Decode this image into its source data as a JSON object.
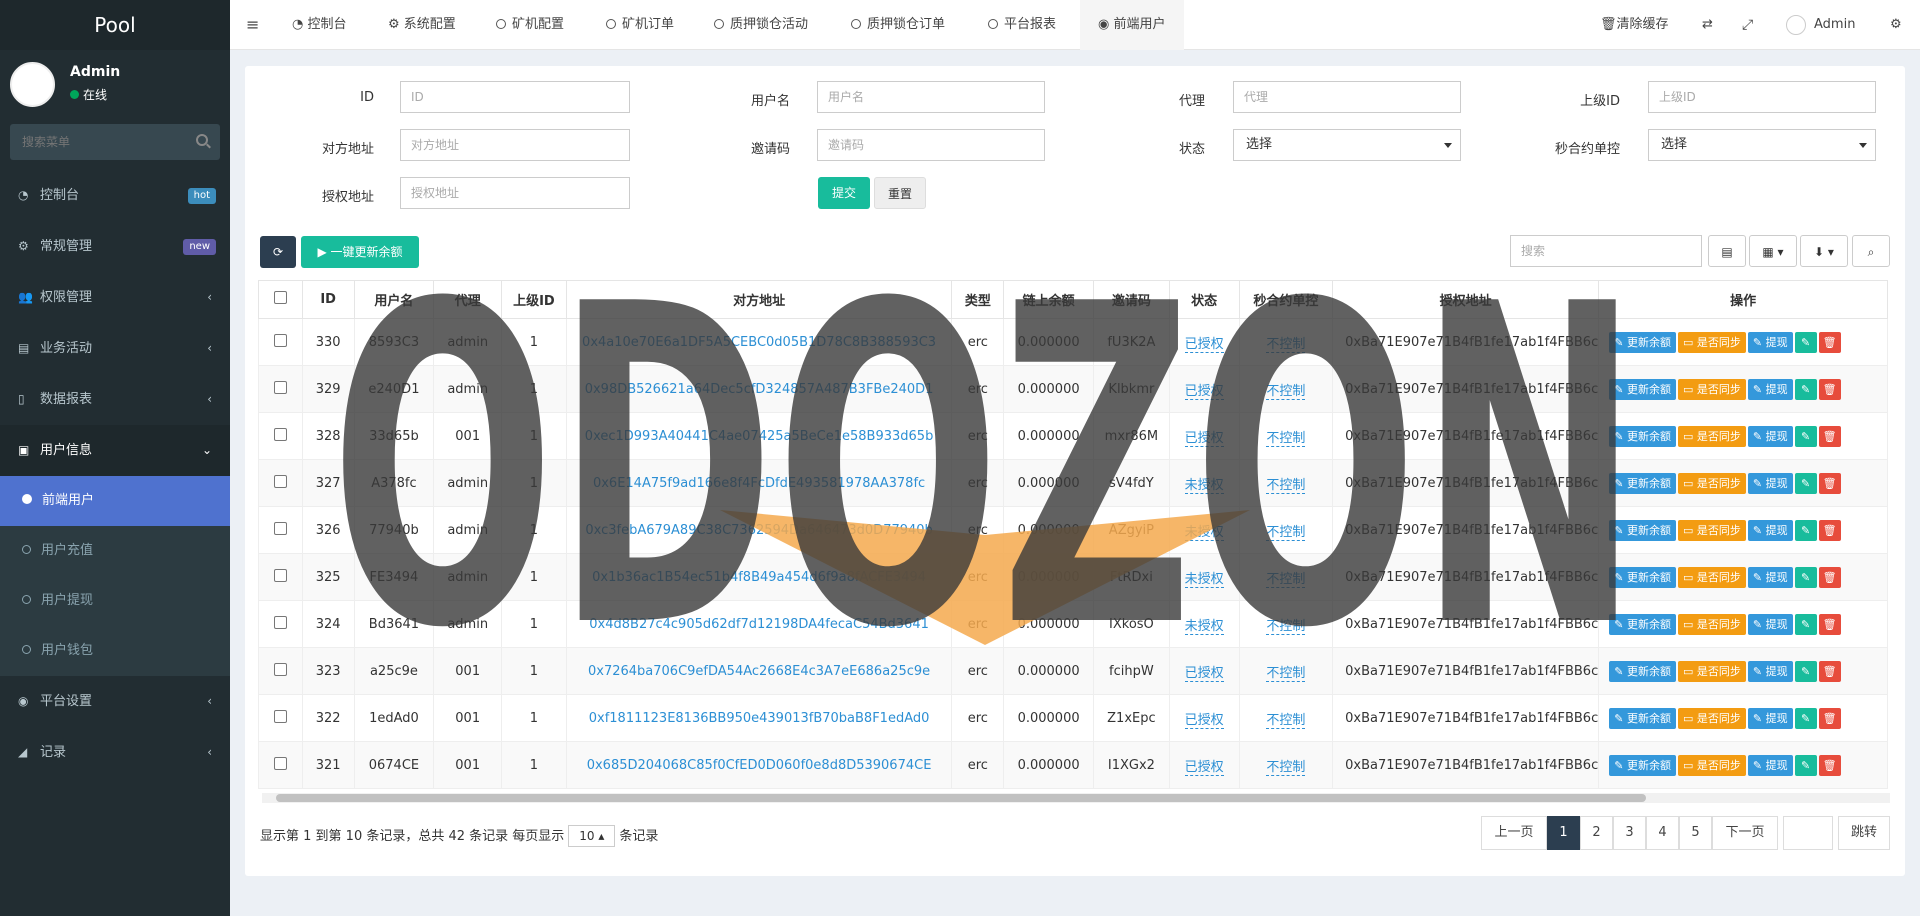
{
  "sidebar": {
    "logo": "Pool",
    "user": {
      "name": "Admin",
      "status": "在线"
    },
    "search_placeholder": "搜索菜单",
    "menu": [
      {
        "label": "控制台",
        "badge": "hot"
      },
      {
        "label": "常规管理",
        "badge": "new"
      },
      {
        "label": "权限管理"
      },
      {
        "label": "业务活动"
      },
      {
        "label": "数据报表"
      },
      {
        "label": "用户信息"
      },
      {
        "label": "平台设置"
      },
      {
        "label": "记录"
      }
    ],
    "submenu": [
      "前端用户",
      "用户充值",
      "用户提现",
      "用户钱包"
    ]
  },
  "topnav": {
    "tabs": [
      "控制台",
      "系统配置",
      "矿机配置",
      "矿机订单",
      "质押锁仓活动",
      "质押锁仓订单",
      "平台报表",
      "前端用户"
    ],
    "clear_cache": "清除缓存",
    "user": "Admin"
  },
  "filters": {
    "id": {
      "label": "ID",
      "placeholder": "ID"
    },
    "username": {
      "label": "用户名",
      "placeholder": "用户名"
    },
    "agent": {
      "label": "代理",
      "placeholder": "代理"
    },
    "parent_id": {
      "label": "上级ID",
      "placeholder": "上级ID"
    },
    "address": {
      "label": "对方地址",
      "placeholder": "对方地址"
    },
    "invite": {
      "label": "邀请码",
      "placeholder": "邀请码"
    },
    "status": {
      "label": "状态",
      "value": "选择"
    },
    "contract": {
      "label": "秒合约单控",
      "value": "选择"
    },
    "auth": {
      "label": "授权地址",
      "placeholder": "授权地址"
    },
    "submit": "提交",
    "reset": "重置"
  },
  "toolbar": {
    "update_all": "一键更新余额",
    "search_placeholder": "搜索"
  },
  "table": {
    "headers": [
      "ID",
      "用户名",
      "代理",
      "上级ID",
      "对方地址",
      "类型",
      "链上余额",
      "邀请码",
      "状态",
      "秒合约单控",
      "授权地址",
      "操作"
    ],
    "rows": [
      [
        "330",
        "8593C3",
        "admin",
        "1",
        "0x4a10e70E6a1DF5A5CEBC0d05B1D78C8B388593C3",
        "erc",
        "0.000000",
        "fU3K2A",
        "已授权",
        "不控制",
        "0xBa71E907e71B4fB1fe17ab1f4FBB6c"
      ],
      [
        "329",
        "e240D1",
        "admin",
        "1",
        "0x98DB526621a64Dec5cfD324857A487B3FBe240D1",
        "erc",
        "0.000000",
        "Klbkmr",
        "已授权",
        "不控制",
        "0xBa71E907e71B4fB1fe17ab1f4FBB6c"
      ],
      [
        "328",
        "33d65b",
        "001",
        "1",
        "0xec1D993A40441C4ae07425a5BeCe1e58B933d65b",
        "erc",
        "0.000000",
        "mxr86M",
        "已授权",
        "不控制",
        "0xBa71E907e71B4fB1fe17ab1f4FBB6c"
      ],
      [
        "327",
        "A378fc",
        "admin",
        "1",
        "0x6E14A75f9ad166e8f4FcDfdE493581978AA378fc",
        "erc",
        "0.000000",
        "sV4fdY",
        "未授权",
        "不控制",
        "0xBa71E907e71B4fB1fe17ab1f4FBB6c"
      ],
      [
        "326",
        "77940b",
        "admin",
        "1",
        "0xc3febA679A89C38C7362594Da646473d0D77940b",
        "erc",
        "0.000000",
        "AZgyiP",
        "未授权",
        "不控制",
        "0xBa71E907e71B4fB1fe17ab1f4FBB6c"
      ],
      [
        "325",
        "FE3494",
        "admin",
        "1",
        "0x1b36ac1B54ec51b4f8B49a454d6f9a8fACFE3494",
        "erc",
        "0.000000",
        "FtRDxi",
        "未授权",
        "不控制",
        "0xBa71E907e71B4fB1fe17ab1f4FBB6c"
      ],
      [
        "324",
        "Bd3641",
        "admin",
        "1",
        "0x4d8B27c4c905d62df7d12198DA4fecaC54Bd3641",
        "erc",
        "0.000000",
        "IXkosO",
        "未授权",
        "不控制",
        "0xBa71E907e71B4fB1fe17ab1f4FBB6c"
      ],
      [
        "323",
        "a25c9e",
        "001",
        "1",
        "0x7264ba706C9efDA54Ac2668E4c3A7eE686a25c9e",
        "erc",
        "0.000000",
        "fcihpW",
        "已授权",
        "不控制",
        "0xBa71E907e71B4fB1fe17ab1f4FBB6c"
      ],
      [
        "322",
        "1edAd0",
        "001",
        "1",
        "0xf1811123E8136BB950e439013fB70baB8F1edAd0",
        "erc",
        "0.000000",
        "Z1xEpc",
        "已授权",
        "不控制",
        "0xBa71E907e71B4fB1fe17ab1f4FBB6c"
      ],
      [
        "321",
        "0674CE",
        "001",
        "1",
        "0x685D204068C85f0CfED0D060f0e8d8D5390674CE",
        "erc",
        "0.000000",
        "I1XGx2",
        "已授权",
        "不控制",
        "0xBa71E907e71B4fB1fe17ab1f4FBB6c"
      ]
    ],
    "ops": [
      "更新余额",
      "是否同步",
      "提现"
    ]
  },
  "pagination": {
    "info_prefix": "显示第 1 到第 10 条记录，总共 42 条记录 每页显示",
    "page_size": "10",
    "info_suffix": "条记录",
    "prev": "上一页",
    "pages": [
      "1",
      "2",
      "3",
      "4",
      "5"
    ],
    "next": "下一页",
    "jump": "跳转"
  },
  "watermark": {
    "text": "ODOZON"
  }
}
